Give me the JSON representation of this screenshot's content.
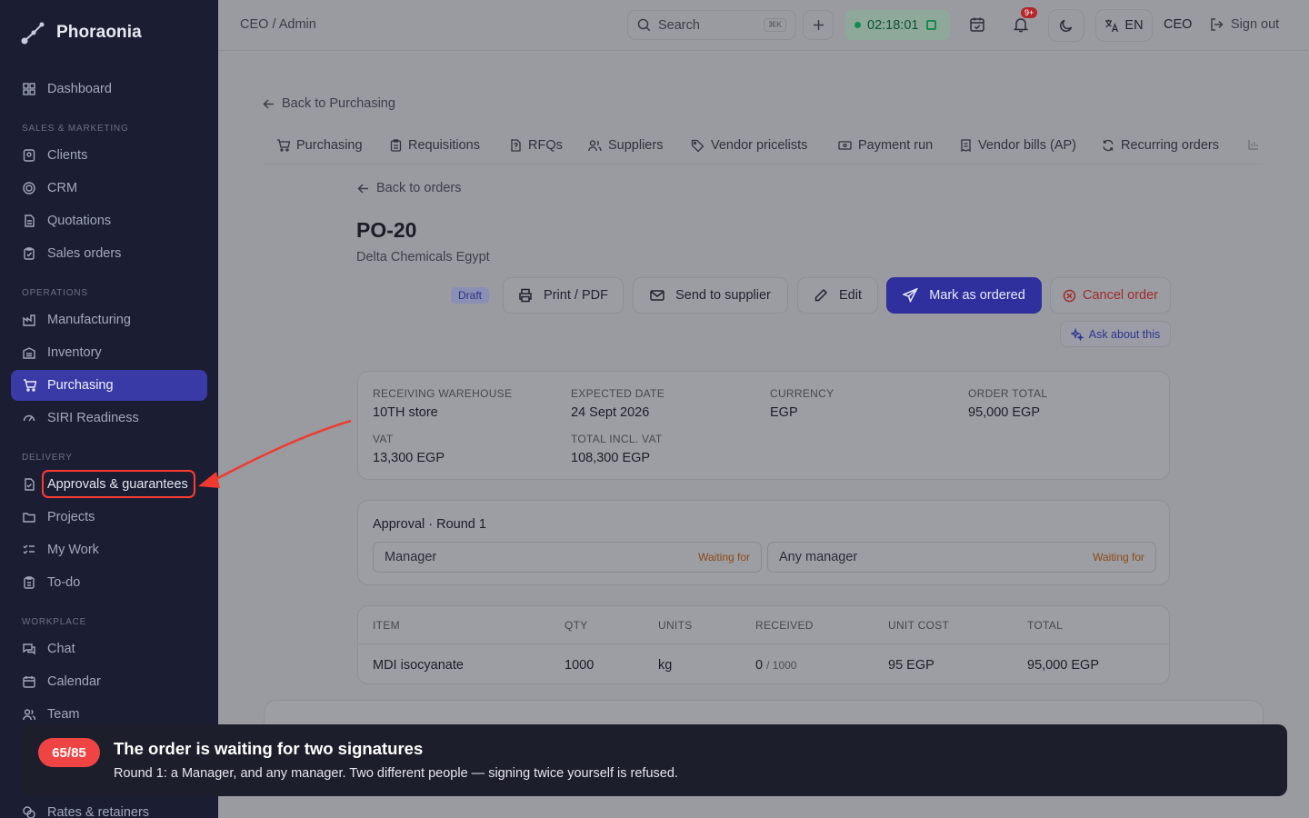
{
  "app": {
    "name": "Phoraonia"
  },
  "sidebar": {
    "dashboard": "Dashboard",
    "sections": {
      "sales": "SALES & MARKETING",
      "operations": "OPERATIONS",
      "delivery": "DELIVERY",
      "workplace": "WORKPLACE"
    },
    "items": {
      "clients": "Clients",
      "crm": "CRM",
      "quotations": "Quotations",
      "sales_orders": "Sales orders",
      "manufacturing": "Manufacturing",
      "inventory": "Inventory",
      "purchasing": "Purchasing",
      "siri": "SIRI Readiness",
      "approvals": "Approvals & guarantees",
      "projects": "Projects",
      "my_work": "My Work",
      "todo": "To-do",
      "chat": "Chat",
      "calendar": "Calendar",
      "team": "Team",
      "rates": "Rates & retainers"
    }
  },
  "topbar": {
    "breadcrumb": "CEO / Admin",
    "search_placeholder": "Search",
    "shortcut": "⌘K",
    "timer": "02:18:01",
    "notif_badge": "9+",
    "language": "EN",
    "role": "CEO",
    "signout": "Sign out"
  },
  "page": {
    "back_purchasing": "Back to Purchasing",
    "tabs": [
      "Purchasing",
      "Requisitions",
      "RFQs",
      "Suppliers",
      "Vendor pricelists",
      "Payment run",
      "Vendor bills (AP)",
      "Recurring orders"
    ],
    "back_orders": "Back to orders",
    "po_number": "PO-20",
    "supplier": "Delta Chemicals Egypt",
    "status": "Draft",
    "actions": {
      "print": "Print / PDF",
      "send": "Send to supplier",
      "edit": "Edit",
      "mark": "Mark as ordered",
      "cancel": "Cancel order",
      "ask": "Ask about this"
    },
    "summary": {
      "warehouse_label": "RECEIVING WAREHOUSE",
      "warehouse": "10TH store",
      "expected_label": "EXPECTED DATE",
      "expected": "24 Sept 2026",
      "currency_label": "CURRENCY",
      "currency": "EGP",
      "total_label": "ORDER TOTAL",
      "total": "95,000 EGP",
      "vat_label": "VAT",
      "vat": "13,300 EGP",
      "total_vat_label": "TOTAL INCL. VAT",
      "total_vat": "108,300 EGP"
    },
    "approval": {
      "title": "Approval · Round 1",
      "slots": [
        {
          "role": "Manager",
          "status": "Waiting for"
        },
        {
          "role": "Any manager",
          "status": "Waiting for"
        }
      ]
    },
    "items_table": {
      "headers": [
        "ITEM",
        "QTY",
        "UNITS",
        "RECEIVED",
        "UNIT COST",
        "TOTAL"
      ],
      "rows": [
        {
          "item": "MDI isocyanate",
          "qty": "1000",
          "units": "kg",
          "received": "0",
          "received_of": "/ 1000",
          "unit_cost": "95 EGP",
          "total": "95,000 EGP"
        }
      ]
    }
  },
  "toast": {
    "step": "65/85",
    "title": "The order is waiting for two signatures",
    "body": "Round 1: a Manager, and any manager. Two different people — signing twice yourself is refused."
  },
  "colors": {
    "sidebar_bg": "#1b1e33",
    "accent": "#3a3aa6",
    "annotation": "#ff3b30"
  }
}
